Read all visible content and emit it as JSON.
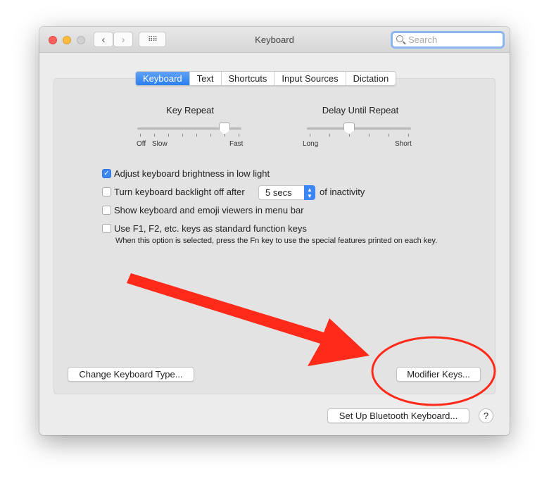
{
  "window": {
    "title": "Keyboard",
    "search_placeholder": "Search"
  },
  "tabs": [
    {
      "label": "Keyboard",
      "active": true
    },
    {
      "label": "Text"
    },
    {
      "label": "Shortcuts"
    },
    {
      "label": "Input Sources"
    },
    {
      "label": "Dictation"
    }
  ],
  "key_repeat": {
    "label": "Key Repeat",
    "min_label": "Off",
    "slow_label": "Slow",
    "max_label": "Fast",
    "ticks": 8,
    "position": 6
  },
  "delay_until_repeat": {
    "label": "Delay Until Repeat",
    "min_label": "Long",
    "max_label": "Short",
    "ticks": 6,
    "position": 2
  },
  "options": [
    {
      "label": "Adjust keyboard brightness in low light",
      "checked": true
    },
    {
      "label": "Turn keyboard backlight off after",
      "checked": false,
      "select_value": "5 secs",
      "suffix": "of inactivity"
    },
    {
      "label": "Show keyboard and emoji viewers in menu bar",
      "checked": false
    },
    {
      "label": "Use F1, F2, etc. keys as standard function keys",
      "checked": false,
      "note": "When this option is selected, press the Fn key to use the special features printed on each key."
    }
  ],
  "buttons": {
    "change_type": "Change Keyboard Type...",
    "modifier": "Modifier Keys...",
    "bluetooth": "Set Up Bluetooth Keyboard...",
    "help": "?"
  },
  "colors": {
    "accent": "#3b86f2",
    "annotation": "#ff2a1a"
  }
}
